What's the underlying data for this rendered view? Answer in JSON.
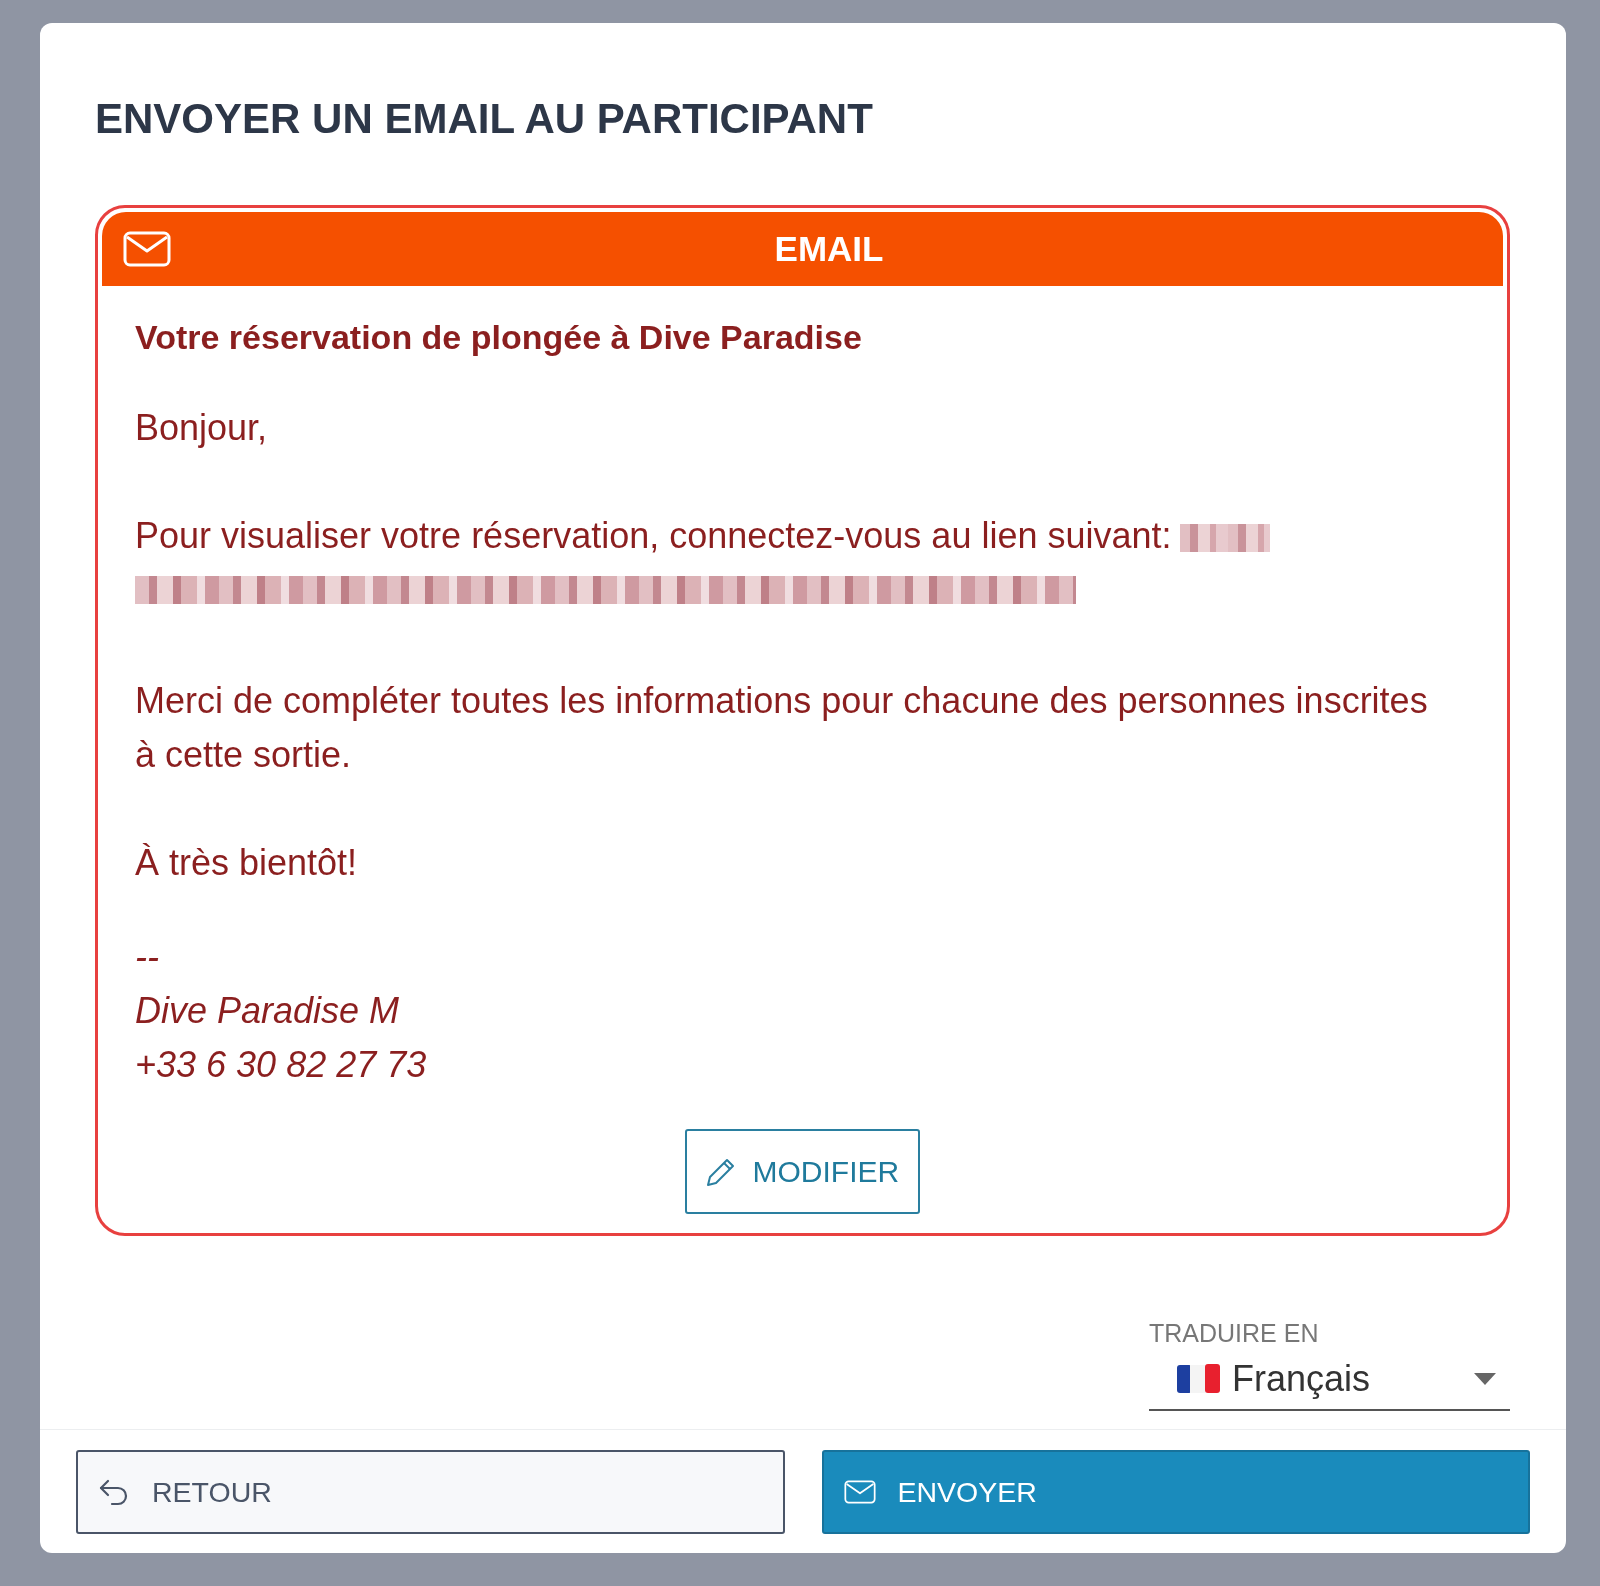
{
  "dialog": {
    "title": "ENVOYER UN EMAIL AU PARTICIPANT"
  },
  "email": {
    "header": "EMAIL",
    "subject": "Votre réservation de plongée à Dive Paradise",
    "paragraphs": [
      {
        "kind": "text",
        "text": "Bonjour,"
      },
      {
        "kind": "text_with_hidden_link",
        "text": "Pour visualiser votre réservation, connectez-vous au lien suivant:"
      },
      {
        "kind": "text",
        "text": "Merci de compléter toutes les informations pour chacune des personnes inscrites à cette sortie."
      },
      {
        "kind": "text",
        "text": "À très bientôt!"
      },
      {
        "kind": "signature",
        "lines": [
          "--",
          "Dive Paradise M",
          "+33 6 30 82 27 73"
        ]
      }
    ],
    "edit_button": "MODIFIER"
  },
  "translate": {
    "label": "TRADUIRE EN",
    "value": "Français"
  },
  "footer": {
    "buttons": [
      {
        "kind": "back",
        "label": "RETOUR"
      },
      {
        "kind": "send",
        "label": "ENVOYER"
      }
    ]
  }
}
